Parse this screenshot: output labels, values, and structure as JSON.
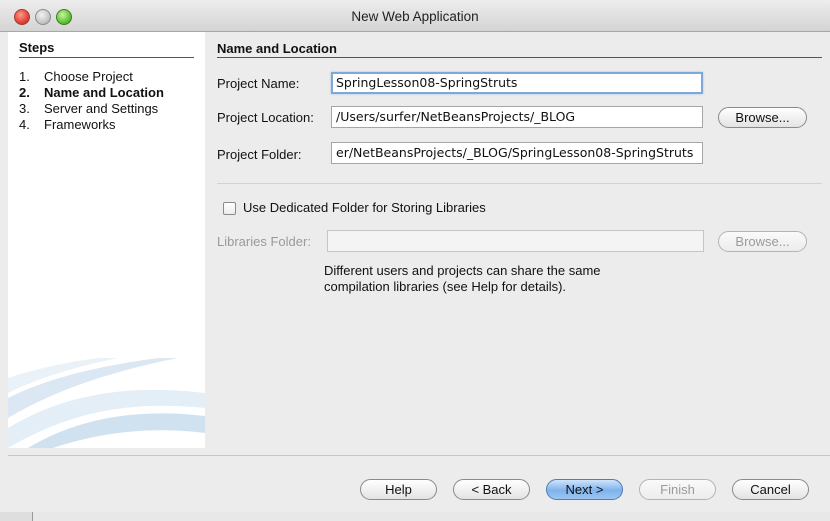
{
  "window": {
    "title": "New Web Application"
  },
  "steps": {
    "heading": "Steps",
    "items": [
      {
        "num": "1.",
        "label": "Choose Project"
      },
      {
        "num": "2.",
        "label": "Name and Location"
      },
      {
        "num": "3.",
        "label": "Server and Settings"
      },
      {
        "num": "4.",
        "label": "Frameworks"
      }
    ],
    "current_index": 1
  },
  "panel": {
    "heading": "Name and Location",
    "project_name_label": "Project Name:",
    "project_name_value": "SpringLesson08-SpringStruts",
    "project_location_label": "Project Location:",
    "project_location_value": "/Users/surfer/NetBeansProjects/_BLOG",
    "project_folder_label": "Project Folder:",
    "project_folder_value": "er/NetBeansProjects/_BLOG/SpringLesson08-SpringStruts",
    "browse_label": "Browse...",
    "dedicated_folder_label": "Use Dedicated Folder for Storing Libraries",
    "dedicated_folder_checked": false,
    "libraries_folder_label": "Libraries Folder:",
    "libraries_folder_value": "",
    "libraries_browse_label": "Browse...",
    "note_line1": "Different users and projects can share the same",
    "note_line2": "compilation libraries (see Help for details)."
  },
  "footer": {
    "help": "Help",
    "back": "< Back",
    "next": "Next >",
    "finish": "Finish",
    "cancel": "Cancel"
  }
}
